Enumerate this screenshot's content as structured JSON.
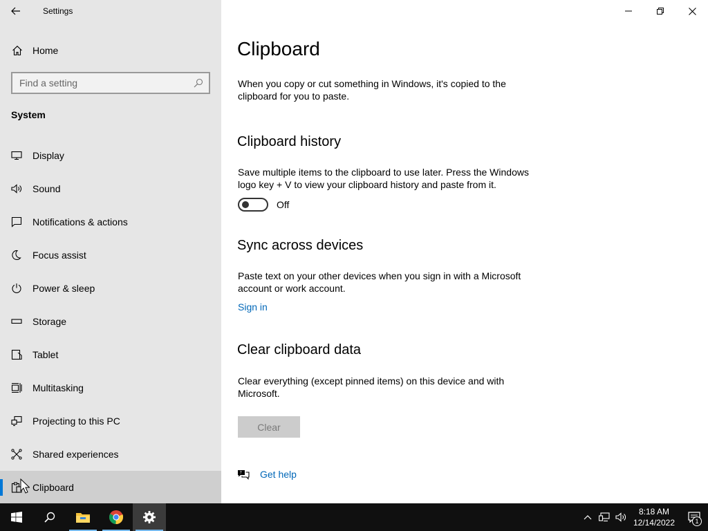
{
  "window": {
    "title": "Settings",
    "controls": {
      "minimize": "minimize-icon",
      "restore": "restore-icon",
      "close": "close-icon"
    }
  },
  "sidebar": {
    "home_label": "Home",
    "search": {
      "placeholder": "Find a setting"
    },
    "section_title": "System",
    "items": [
      {
        "label": "Display",
        "icon": "display-icon"
      },
      {
        "label": "Sound",
        "icon": "sound-icon"
      },
      {
        "label": "Notifications & actions",
        "icon": "notifications-icon"
      },
      {
        "label": "Focus assist",
        "icon": "focus-assist-icon"
      },
      {
        "label": "Power & sleep",
        "icon": "power-icon"
      },
      {
        "label": "Storage",
        "icon": "storage-icon"
      },
      {
        "label": "Tablet",
        "icon": "tablet-icon"
      },
      {
        "label": "Multitasking",
        "icon": "multitasking-icon"
      },
      {
        "label": "Projecting to this PC",
        "icon": "projecting-icon"
      },
      {
        "label": "Shared experiences",
        "icon": "shared-experiences-icon"
      },
      {
        "label": "Clipboard",
        "icon": "clipboard-icon",
        "selected": true
      }
    ]
  },
  "main": {
    "title": "Clipboard",
    "intro": "When you copy or cut something in Windows, it's copied to the clipboard for you to paste.",
    "history": {
      "heading": "Clipboard history",
      "description": "Save multiple items to the clipboard to use later. Press the Windows logo key + V to view your clipboard history and paste from it.",
      "toggle_state": "Off"
    },
    "sync": {
      "heading": "Sync across devices",
      "description": "Paste text on your other devices when you sign in with a Microsoft account or work account.",
      "link": "Sign in"
    },
    "clear": {
      "heading": "Clear clipboard data",
      "description": "Clear everything (except pinned items) on this device and with Microsoft.",
      "button": "Clear"
    },
    "help_link": "Get help"
  },
  "taskbar": {
    "apps": [
      "start-icon",
      "search-icon",
      "file-explorer-icon",
      "chrome-icon",
      "settings-icon"
    ],
    "clock": {
      "time": "8:18 AM",
      "date": "12/14/2022"
    },
    "notification_count": "1"
  },
  "colors": {
    "accent": "#0078d7",
    "link": "#0067b8",
    "sidebar_bg": "#e6e6e6",
    "taskbar_bg": "#101010"
  }
}
